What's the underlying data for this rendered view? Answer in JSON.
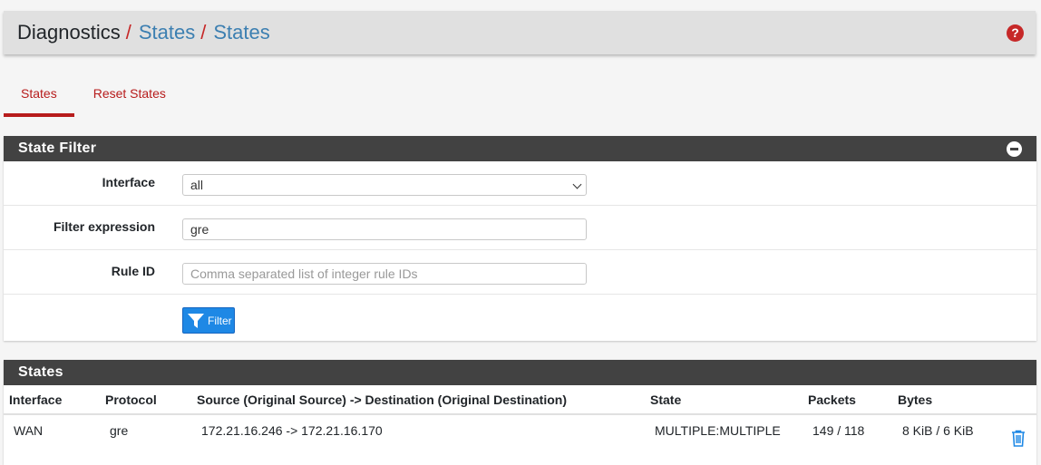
{
  "breadcrumb": {
    "root": "Diagnostics",
    "separator": "/",
    "items": [
      "States",
      "States"
    ]
  },
  "tabs": [
    {
      "label": "States",
      "active": true
    },
    {
      "label": "Reset States",
      "active": false
    }
  ],
  "filter_panel": {
    "title": "State Filter",
    "interface": {
      "label": "Interface",
      "value": "all"
    },
    "expression": {
      "label": "Filter expression",
      "value": "gre"
    },
    "rule_id": {
      "label": "Rule ID",
      "value": "",
      "placeholder": "Comma separated list of integer rule IDs"
    },
    "filter_button": "Filter"
  },
  "states_panel": {
    "title": "States",
    "columns": [
      "Interface",
      "Protocol",
      "Source (Original Source) -> Destination (Original Destination)",
      "State",
      "Packets",
      "Bytes"
    ],
    "rows": [
      {
        "interface": "WAN",
        "protocol": "gre",
        "source_dest": "172.21.16.246 -> 172.21.16.170",
        "state": "MULTIPLE:MULTIPLE",
        "packets": "149 / 118",
        "bytes": "8 KiB / 6 KiB"
      }
    ]
  },
  "colors": {
    "accent_red": "#b71c1c",
    "link_blue": "#3c7fb1",
    "button_blue": "#1e88e5",
    "panel_head": "#424242"
  },
  "icons": [
    "help-icon",
    "collapse-icon",
    "filter-icon",
    "chevron-down-icon",
    "trash-icon"
  ]
}
